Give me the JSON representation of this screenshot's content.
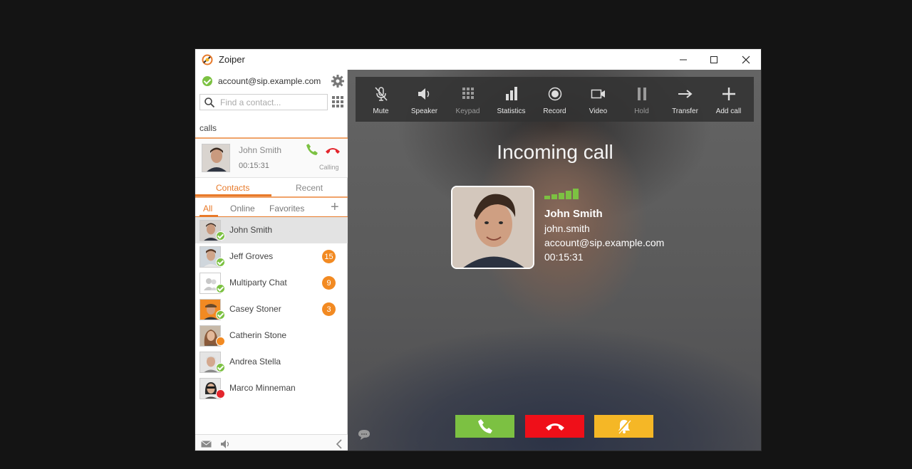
{
  "window": {
    "title": "Zoiper",
    "controls": {
      "minimize": "—",
      "maximize": "☐",
      "close": "✕"
    }
  },
  "sidebar": {
    "account": "account@sip.example.com",
    "search_placeholder": "Find a contact...",
    "calls_label": "calls",
    "active_call": {
      "name": "John Smith",
      "duration": "00:15:31",
      "status": "Calling"
    },
    "tabs": [
      "Contacts",
      "Recent"
    ],
    "filters": [
      "All",
      "Online",
      "Favorites"
    ],
    "add_contact": "+",
    "contacts": [
      {
        "name": "John Smith",
        "status": "online",
        "badge": ""
      },
      {
        "name": "Jeff Groves",
        "status": "online",
        "badge": "15"
      },
      {
        "name": "Multiparty Chat",
        "status": "online",
        "badge": "9"
      },
      {
        "name": "Casey Stoner",
        "status": "online",
        "badge": "3"
      },
      {
        "name": "Catherin Stone",
        "status": "away",
        "badge": ""
      },
      {
        "name": "Andrea Stella",
        "status": "online",
        "badge": ""
      },
      {
        "name": "Marco Minneman",
        "status": "busy",
        "badge": ""
      }
    ]
  },
  "toolbar": {
    "items": [
      {
        "label": "Mute",
        "icon": "microphone-muted-icon",
        "enabled": true
      },
      {
        "label": "Speaker",
        "icon": "speaker-icon",
        "enabled": true
      },
      {
        "label": "Keypad",
        "icon": "keypad-icon",
        "enabled": false
      },
      {
        "label": "Statistics",
        "icon": "statistics-icon",
        "enabled": true
      },
      {
        "label": "Record",
        "icon": "record-icon",
        "enabled": true
      },
      {
        "label": "Video",
        "icon": "video-icon",
        "enabled": true
      },
      {
        "label": "Hold",
        "icon": "pause-icon",
        "enabled": false
      },
      {
        "label": "Transfer",
        "icon": "transfer-arrow-icon",
        "enabled": true
      },
      {
        "label": "Add call",
        "icon": "plus-icon",
        "enabled": true
      }
    ]
  },
  "call": {
    "title": "Incoming call",
    "caller_name": "John Smith",
    "caller_username": "john.smith",
    "caller_account": "account@sip.example.com",
    "duration": "00:15:31",
    "signal_bars": 5
  },
  "actions": {
    "answer": "phone-answer-icon",
    "reject": "phone-hangup-icon",
    "silence": "bell-muted-icon"
  },
  "colors": {
    "accent": "#e87a2a",
    "online": "#7cc142",
    "away": "#f28a22",
    "busy": "#e3262d",
    "answer": "#7cc142",
    "reject": "#ef0f19",
    "silence": "#f5b726"
  }
}
